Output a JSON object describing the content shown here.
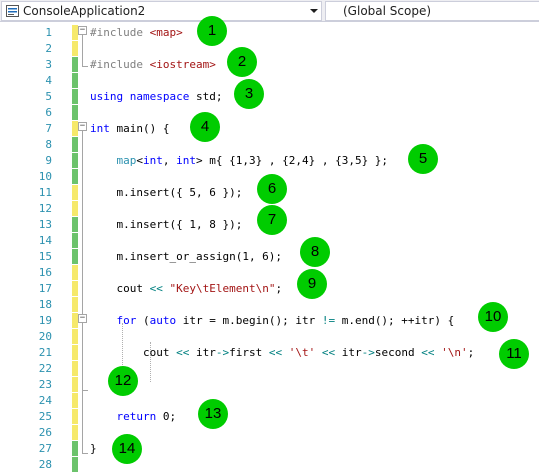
{
  "toolbar": {
    "project": "ConsoleApplication2",
    "scope": "(Global Scope)"
  },
  "lines": [
    {
      "num": "1",
      "change": "yellow",
      "tokens": [
        {
          "t": "#include ",
          "c": "pp"
        },
        {
          "t": "<map>",
          "c": "inc"
        }
      ]
    },
    {
      "num": "2",
      "change": "yellow",
      "tokens": []
    },
    {
      "num": "3",
      "change": "green",
      "tokens": [
        {
          "t": "#include ",
          "c": "pp"
        },
        {
          "t": "<iostream>",
          "c": "inc"
        }
      ]
    },
    {
      "num": "4",
      "change": "green",
      "tokens": []
    },
    {
      "num": "5",
      "change": "green",
      "tokens": [
        {
          "t": "using ",
          "c": "kw"
        },
        {
          "t": "namespace ",
          "c": "kw"
        },
        {
          "t": "std;",
          "c": ""
        }
      ]
    },
    {
      "num": "6",
      "change": "green",
      "tokens": []
    },
    {
      "num": "7",
      "change": "yellow",
      "tokens": [
        {
          "t": "int ",
          "c": "kw"
        },
        {
          "t": "main() {",
          "c": ""
        }
      ]
    },
    {
      "num": "8",
      "change": "green",
      "tokens": []
    },
    {
      "num": "9",
      "change": "green",
      "tokens": [
        {
          "t": "    ",
          "c": ""
        },
        {
          "t": "map",
          "c": "ty"
        },
        {
          "t": "<",
          "c": ""
        },
        {
          "t": "int",
          "c": "kw"
        },
        {
          "t": ", ",
          "c": ""
        },
        {
          "t": "int",
          "c": "kw"
        },
        {
          "t": "> m{ {1,3} , {2,4} , {3,5} };",
          "c": ""
        }
      ]
    },
    {
      "num": "10",
      "change": "green",
      "tokens": []
    },
    {
      "num": "11",
      "change": "yellow",
      "tokens": [
        {
          "t": "    m.insert({ 5, 6 });",
          "c": ""
        }
      ]
    },
    {
      "num": "12",
      "change": "yellow",
      "tokens": []
    },
    {
      "num": "13",
      "change": "green",
      "tokens": [
        {
          "t": "    m.insert({ 1, 8 });",
          "c": ""
        }
      ]
    },
    {
      "num": "14",
      "change": "green",
      "tokens": []
    },
    {
      "num": "15",
      "change": "green",
      "tokens": [
        {
          "t": "    m.insert_or_assign(1, 6);",
          "c": ""
        }
      ]
    },
    {
      "num": "16",
      "change": "yellow",
      "tokens": []
    },
    {
      "num": "17",
      "change": "yellow",
      "tokens": [
        {
          "t": "    cout ",
          "c": ""
        },
        {
          "t": "<<",
          "c": "op"
        },
        {
          "t": " ",
          "c": ""
        },
        {
          "t": "\"Key\\tElement\\n\"",
          "c": "str"
        },
        {
          "t": ";",
          "c": ""
        }
      ]
    },
    {
      "num": "18",
      "change": "yellow",
      "tokens": []
    },
    {
      "num": "19",
      "change": "yellow",
      "tokens": [
        {
          "t": "    ",
          "c": ""
        },
        {
          "t": "for ",
          "c": "kw"
        },
        {
          "t": "(",
          "c": ""
        },
        {
          "t": "auto ",
          "c": "kw"
        },
        {
          "t": "itr = m.begin(); itr ",
          "c": ""
        },
        {
          "t": "!=",
          "c": "op"
        },
        {
          "t": " m.end(); ++itr) {",
          "c": ""
        }
      ]
    },
    {
      "num": "20",
      "change": "yellow",
      "tokens": []
    },
    {
      "num": "21",
      "change": "yellow",
      "tokens": [
        {
          "t": "        cout ",
          "c": ""
        },
        {
          "t": "<<",
          "c": "op"
        },
        {
          "t": " itr",
          "c": ""
        },
        {
          "t": "->",
          "c": "op"
        },
        {
          "t": "first ",
          "c": ""
        },
        {
          "t": "<<",
          "c": "op"
        },
        {
          "t": " ",
          "c": ""
        },
        {
          "t": "'\\t'",
          "c": "str"
        },
        {
          "t": " ",
          "c": ""
        },
        {
          "t": "<<",
          "c": "op"
        },
        {
          "t": " itr",
          "c": ""
        },
        {
          "t": "->",
          "c": "op"
        },
        {
          "t": "second ",
          "c": ""
        },
        {
          "t": "<<",
          "c": "op"
        },
        {
          "t": " ",
          "c": ""
        },
        {
          "t": "'\\n'",
          "c": "str"
        },
        {
          "t": ";",
          "c": ""
        }
      ]
    },
    {
      "num": "22",
      "change": "yellow",
      "tokens": []
    },
    {
      "num": "23",
      "change": "yellow",
      "tokens": [
        {
          "t": "    }",
          "c": ""
        }
      ]
    },
    {
      "num": "24",
      "change": "yellow",
      "tokens": []
    },
    {
      "num": "25",
      "change": "yellow",
      "tokens": [
        {
          "t": "    ",
          "c": ""
        },
        {
          "t": "return ",
          "c": "kw"
        },
        {
          "t": "0;",
          "c": ""
        }
      ]
    },
    {
      "num": "26",
      "change": "yellow",
      "tokens": []
    },
    {
      "num": "27",
      "change": "green",
      "tokens": [
        {
          "t": "}",
          "c": ""
        }
      ]
    },
    {
      "num": "28",
      "change": "green",
      "tokens": []
    }
  ],
  "badges": [
    "1",
    "2",
    "3",
    "4",
    "5",
    "6",
    "7",
    "8",
    "9",
    "10",
    "11",
    "12",
    "13",
    "14"
  ],
  "colors": {
    "badge": "#00cc00",
    "line_number": "#2b91af",
    "keyword": "#0000ff",
    "string": "#a31515",
    "preprocessor": "#808080",
    "change_saved": "#6cc36c",
    "change_unsaved": "#f6e96b"
  }
}
